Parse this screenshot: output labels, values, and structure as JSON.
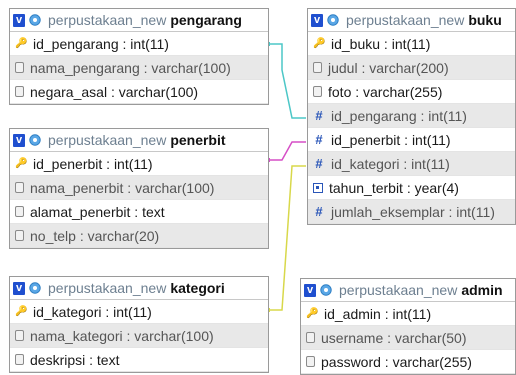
{
  "colors": {
    "badge": "#1f4fcf",
    "db_text": "#6d7f90",
    "link_cyan": "#4cc7c7",
    "link_magenta": "#d64fc6",
    "link_yellow": "#d8d84a"
  },
  "tables": {
    "pengarang": {
      "db": "perpustakaan_new",
      "name": "pengarang",
      "columns": [
        {
          "text": "id_pengarang : int(11)",
          "icon": "key-icon"
        },
        {
          "text": "nama_pengarang : varchar(100)",
          "icon": "field-icon"
        },
        {
          "text": "negara_asal : varchar(100)",
          "icon": "field-icon"
        }
      ]
    },
    "penerbit": {
      "db": "perpustakaan_new",
      "name": "penerbit",
      "columns": [
        {
          "text": "id_penerbit : int(11)",
          "icon": "key-icon"
        },
        {
          "text": "nama_penerbit : varchar(100)",
          "icon": "field-icon"
        },
        {
          "text": "alamat_penerbit : text",
          "icon": "field-icon"
        },
        {
          "text": "no_telp : varchar(20)",
          "icon": "field-icon"
        }
      ]
    },
    "kategori": {
      "db": "perpustakaan_new",
      "name": "kategori",
      "columns": [
        {
          "text": "id_kategori : int(11)",
          "icon": "key-icon"
        },
        {
          "text": "nama_kategori : varchar(100)",
          "icon": "field-icon"
        },
        {
          "text": "deskripsi : text",
          "icon": "field-icon"
        }
      ]
    },
    "buku": {
      "db": "perpustakaan_new",
      "name": "buku",
      "columns": [
        {
          "text": "id_buku : int(11)",
          "icon": "key-icon"
        },
        {
          "text": "judul : varchar(200)",
          "icon": "field-icon"
        },
        {
          "text": "foto : varchar(255)",
          "icon": "field-icon"
        },
        {
          "text": "id_pengarang : int(11)",
          "icon": "hash-icon"
        },
        {
          "text": "id_penerbit : int(11)",
          "icon": "hash-icon"
        },
        {
          "text": "id_kategori : int(11)",
          "icon": "hash-icon"
        },
        {
          "text": "tahun_terbit : year(4)",
          "icon": "calendar-icon"
        },
        {
          "text": "jumlah_eksemplar : int(11)",
          "icon": "hash-icon"
        }
      ]
    },
    "admin": {
      "db": "perpustakaan_new",
      "name": "admin",
      "columns": [
        {
          "text": "id_admin : int(11)",
          "icon": "key-icon"
        },
        {
          "text": "username : varchar(50)",
          "icon": "field-icon"
        },
        {
          "text": "password : varchar(255)",
          "icon": "field-icon"
        }
      ]
    }
  }
}
